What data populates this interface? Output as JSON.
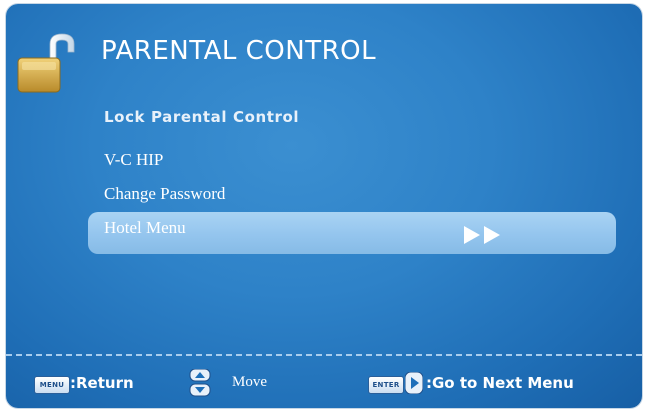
{
  "title": "PARENTAL CONTROL",
  "menu": {
    "items": [
      {
        "label": "Lock Parental Control",
        "state": "disabled"
      },
      {
        "label": "V-C HIP",
        "state": "normal"
      },
      {
        "label": "Change Password",
        "state": "normal"
      },
      {
        "label": "Hotel Menu",
        "state": "selected"
      }
    ]
  },
  "footer": {
    "menu_key": "MENU",
    "return_label": ":Return",
    "move_label": "Move",
    "enter_key": "ENTER",
    "next_label": ":Go to Next Menu"
  },
  "icons": {
    "lock": "unlocked-padlock-icon",
    "arrows": "double-right-arrow-icon",
    "updown": "up-down-arrow-icon",
    "right": "right-arrow-icon"
  },
  "colors": {
    "background": "#2e82c8",
    "selected_row": "#94c5ee",
    "text": "#ffffff",
    "padlock": "#d9b24c"
  }
}
